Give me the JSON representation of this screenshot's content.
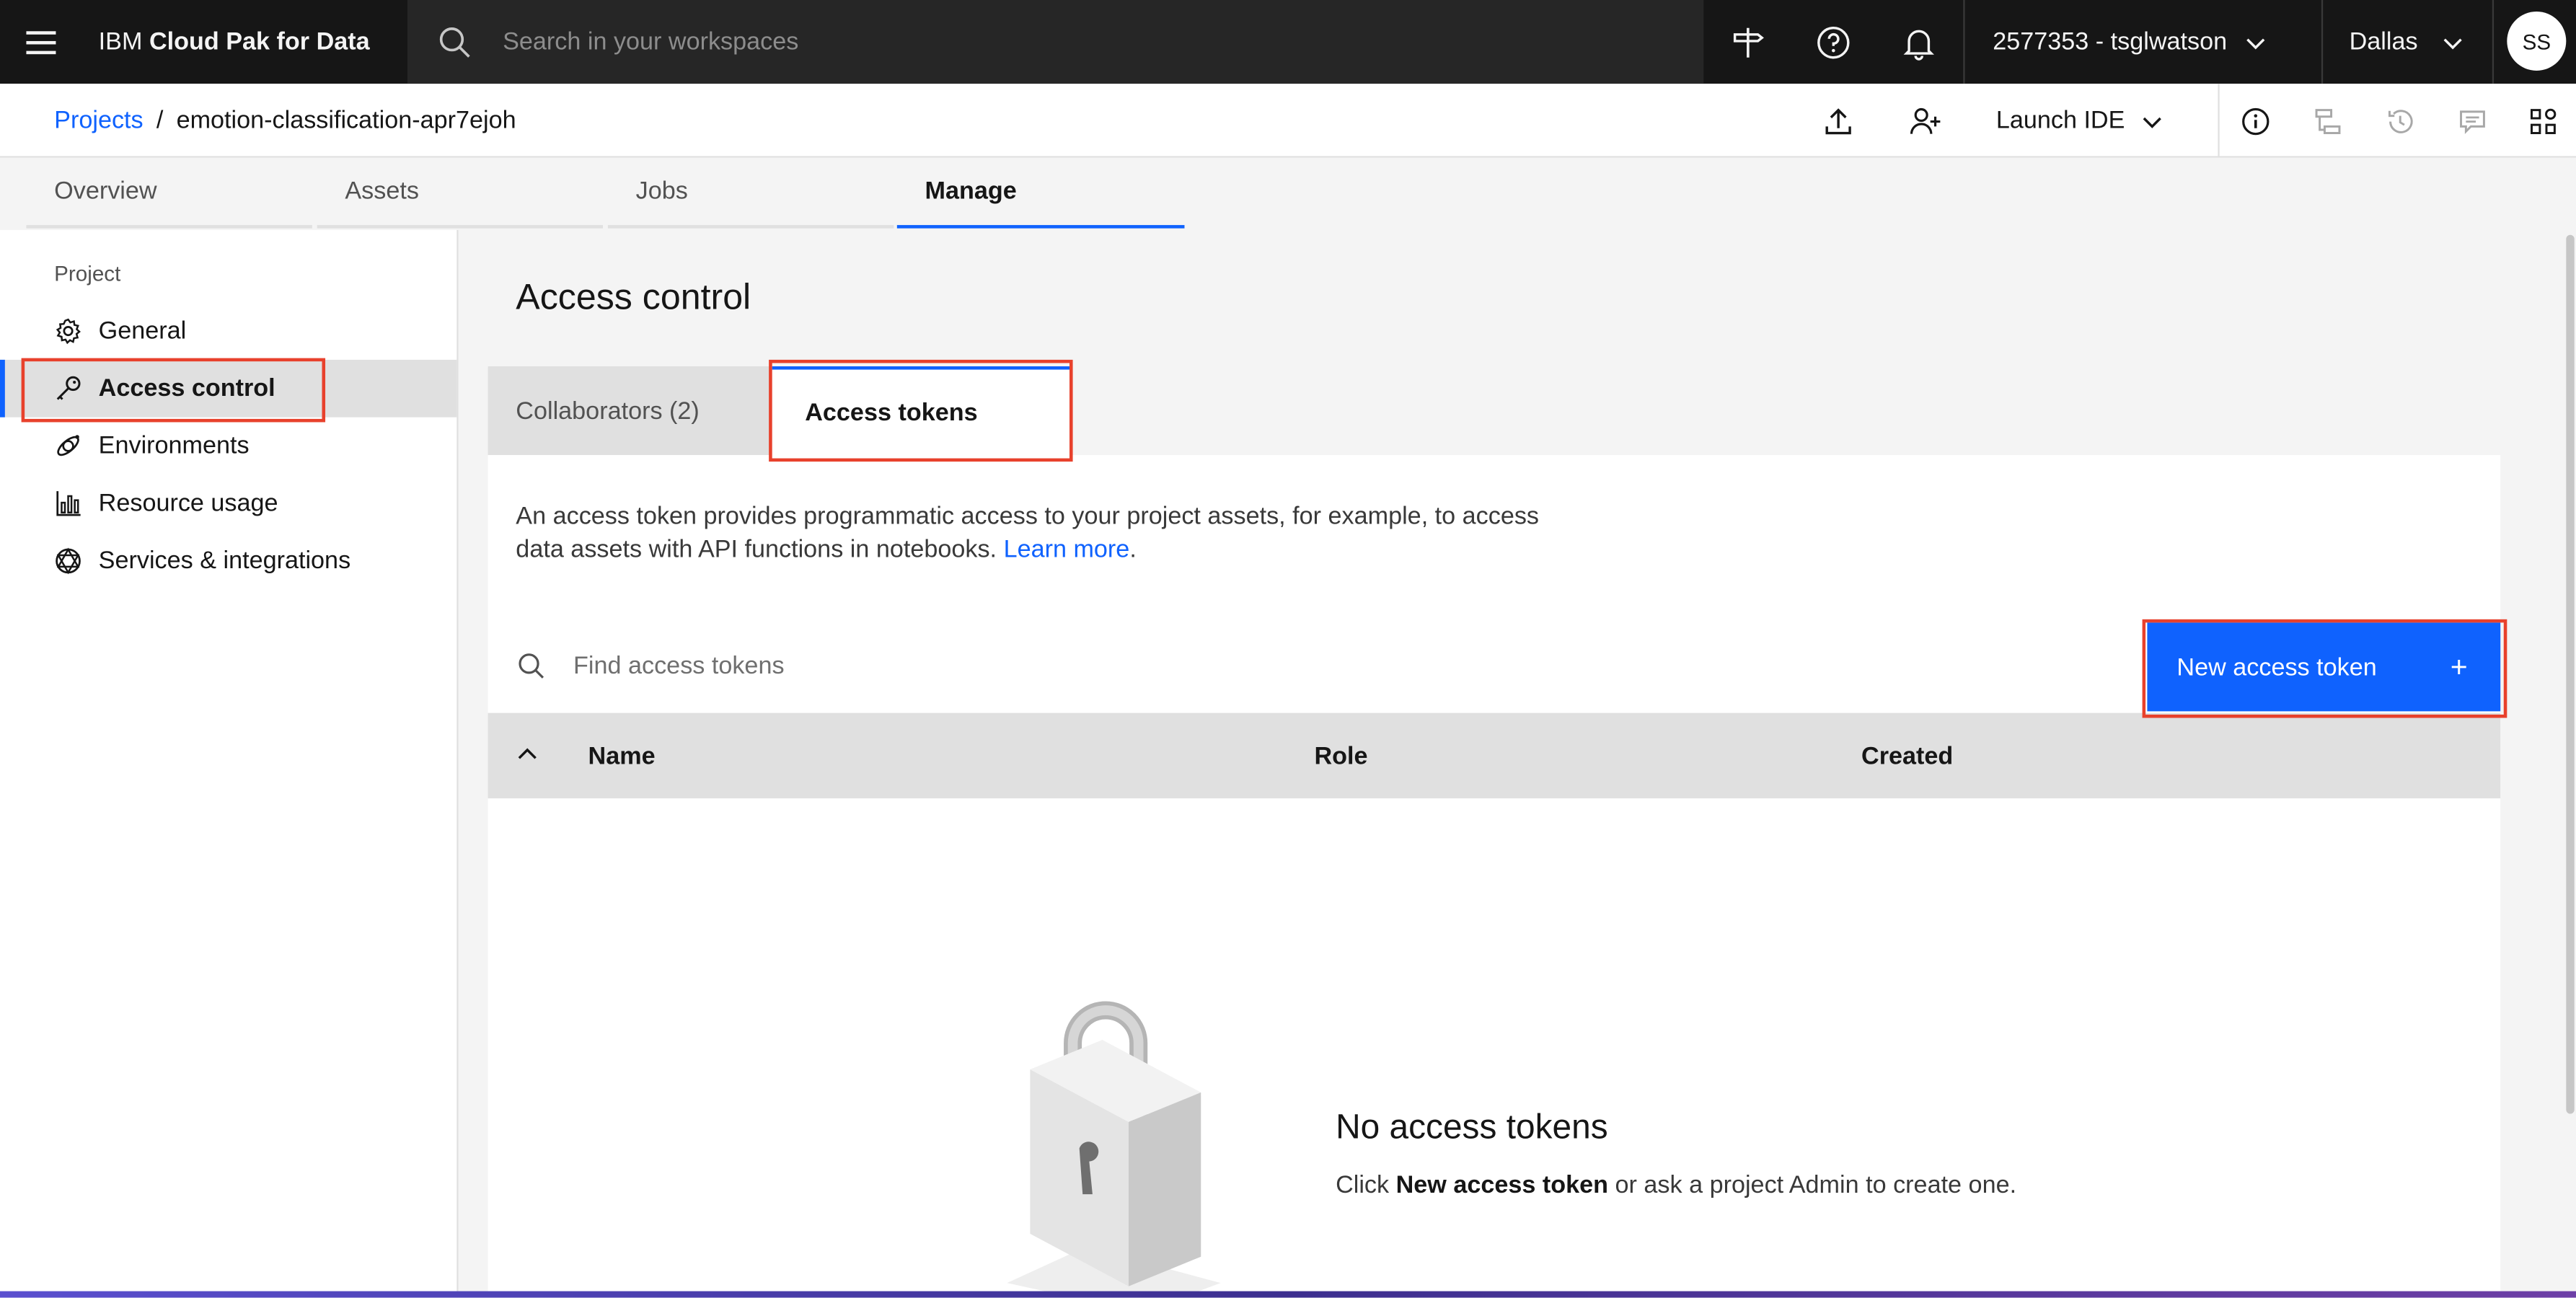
{
  "header": {
    "brand_prefix": "IBM ",
    "brand_bold": "Cloud Pak for Data",
    "search_placeholder": "Search in your workspaces",
    "account": "2577353 - tsglwatson",
    "region": "Dallas",
    "avatar_initials": "SS",
    "icons": [
      "menu-icon",
      "search-icon",
      "signpost-icon",
      "help-icon",
      "notification-icon",
      "chevron-down-icon",
      "chevron-down-icon"
    ]
  },
  "breadcrumb": {
    "root": "Projects",
    "separator": "/",
    "current": "emotion-classification-apr7ejoh"
  },
  "toolbar": {
    "launch_ide": "Launch IDE",
    "icons": [
      "upload-icon",
      "add-collaborator-icon",
      "chevron-down-icon",
      "info-icon",
      "lineage-icon",
      "history-icon",
      "comment-icon",
      "apps-icon"
    ]
  },
  "tabs": [
    {
      "label": "Overview"
    },
    {
      "label": "Assets"
    },
    {
      "label": "Jobs"
    },
    {
      "label": "Manage",
      "active": true
    }
  ],
  "sidebar": {
    "section": "Project",
    "items": [
      {
        "label": "General",
        "icon": "gear-icon"
      },
      {
        "label": "Access control",
        "icon": "key-icon",
        "active": true
      },
      {
        "label": "Environments",
        "icon": "environment-icon"
      },
      {
        "label": "Resource usage",
        "icon": "chart-icon"
      },
      {
        "label": "Services & integrations",
        "icon": "services-icon"
      }
    ]
  },
  "main": {
    "title": "Access control",
    "subtabs": [
      {
        "label": "Collaborators (2)"
      },
      {
        "label": "Access tokens",
        "active": true
      }
    ],
    "description": "An access token provides programmatic access to your project assets, for example, to access data assets with API functions in notebooks.",
    "learn_more": "Learn more",
    "learn_more_suffix": ".",
    "find_placeholder": "Find access tokens",
    "new_button": "New access token",
    "new_button_icon": "+",
    "columns": [
      "Name",
      "Role",
      "Created"
    ],
    "empty_title": "No access tokens",
    "empty_prefix": "Click ",
    "empty_bold": "New access token",
    "empty_suffix": " or ask a project Admin to create one."
  },
  "colors": {
    "accent": "#0f62fe",
    "highlight": "#e8412c",
    "header_bg": "#161616"
  }
}
